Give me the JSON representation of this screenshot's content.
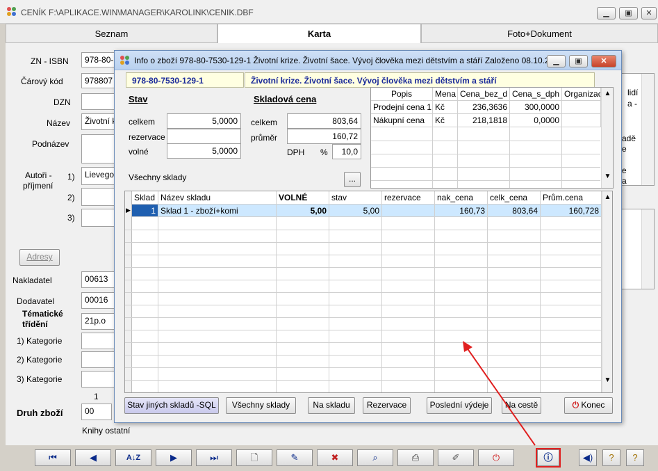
{
  "window": {
    "title": "CENÍK F:\\APLIKACE.WIN\\MANAGER\\KAROLINK\\CENIK.DBF"
  },
  "tabs": [
    {
      "label": "Seznam"
    },
    {
      "label": "Karta"
    },
    {
      "label": "Foto+Dokument"
    }
  ],
  "form": {
    "zn_isbn_label": "ZN - ISBN",
    "zn_isbn_value": "978-80-",
    "carovy_label": "Čárový kód",
    "carovy_value": "978807",
    "dzn_label": "DZN",
    "nazev_label": "Název",
    "nazev_value": "Životní k",
    "podnazev_label": "Podnázev",
    "autori_label": "Autoři -",
    "prijmeni_label": "příjmení",
    "a1": "1)",
    "a1_value": "Lievego",
    "a2": "2)",
    "a3": "3)",
    "adresy": "Adresy",
    "nakladatel_label": "Nakladatel",
    "nakladatel_value": "00613",
    "dodavatel_label": "Dodavatel",
    "dodavatel_value": "00016",
    "tematicke_label": "Tématické",
    "trideni_label": "třídění",
    "tematicke_value": "21p.o",
    "kat1": "1) Kategorie",
    "kat2": "2) Kategorie",
    "kat3": "3) Kategorie",
    "one": "1",
    "druh_label": "Druh zboží",
    "druh_value": "00",
    "druh_text": "Knihy ostatní",
    "right_text": [
      "lidí",
      "a -",
      "adě",
      "e",
      "e",
      "a"
    ]
  },
  "dialog": {
    "title": "Info o zboží 978-80-7530-129-1 Životní krize. Životní šace. Vývoj člověka mezi dětstvím a stáří Založeno 08.10.2...",
    "code": "978-80-7530-129-1",
    "name": "Životní krize. Životní šace. Vývoj člověka mezi dětstvím a stáří",
    "stav_header": "Stav",
    "celkem_label": "celkem",
    "celkem_value": "5,0000",
    "rezervace_label": "rezervace",
    "rezervace_value": "",
    "volne_label": "volné",
    "volne_value": "5,0000",
    "skladova_header": "Skladová cena",
    "sk_celkem_label": "celkem",
    "sk_celkem_value": "803,64",
    "prumer_label": "průměr",
    "prumer_value": "160,72",
    "dph_label": "DPH",
    "pct": "%",
    "dph_value": "10,0",
    "vsechny_sklady": "Všechny sklady",
    "dots": "...",
    "price_cols": [
      "Popis",
      "Mena",
      "Cena_bez_d",
      "Cena_s_dph",
      "Organizac"
    ],
    "price_rows": [
      [
        "Prodejní cena 1",
        "Kč",
        "236,3636",
        "300,0000",
        ""
      ],
      [
        "Nákupní cena",
        "Kč",
        "218,1818",
        "0,0000",
        ""
      ]
    ],
    "stock_cols": [
      "Sklad",
      "Název skladu",
      "VOLNÉ",
      "stav",
      "rezervace",
      "nak_cena",
      "celk_cena",
      "Prům.cena"
    ],
    "stock_rows": [
      [
        "1",
        "Sklad 1 - zboží+komi",
        "5,00",
        "5,00",
        "",
        "160,73",
        "803,64",
        "160,728"
      ]
    ],
    "buttons": [
      "Stav jiných skladů -SQL",
      "Všechny sklady",
      "Na skladu",
      "Rezervace",
      "Poslední výdeje",
      "Na cestě",
      "Konec"
    ]
  },
  "toolbar": {
    "icons": [
      "first-record-icon",
      "prev-record-icon",
      "sort-icon",
      "next-record-icon",
      "last-record-icon",
      "new-document-icon",
      "edit-icon",
      "delete-icon",
      "search-icon",
      "print-icon",
      "filter-icon",
      "power-icon",
      "info-icon",
      "speaker-icon",
      "help-icon",
      "help-alt-icon"
    ]
  },
  "colors": {
    "highlight": "#e02020",
    "selected_row": "#cde8ff",
    "title_blue": "#1a2a9a"
  }
}
